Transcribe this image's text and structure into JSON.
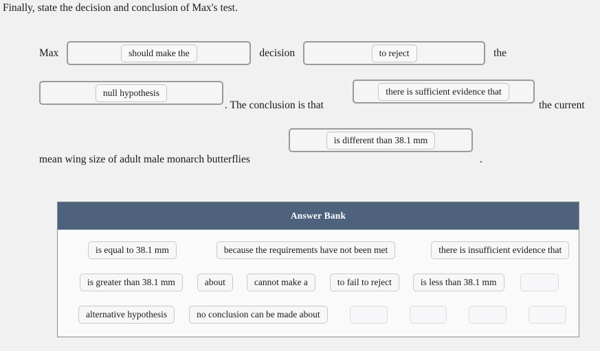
{
  "prompt": "Finally, state the decision and conclusion of Max's test.",
  "sentence": {
    "line1": {
      "lead": "Max",
      "slot1_value": "should make the",
      "mid": "decision",
      "slot2_value": "to reject",
      "tail": "the"
    },
    "line2": {
      "slot3_value": "null hypothesis",
      "mid": ". The conclusion is that",
      "slot4_value": "there is sufficient evidence that",
      "tail": "the current"
    },
    "line3": {
      "slot5_value": "is different than 38.1 mm",
      "lead": "mean wing size of adult male monarch butterflies",
      "period": "."
    }
  },
  "answer_bank": {
    "title": "Answer Bank",
    "rows": [
      [
        {
          "label": "is equal to 38.1 mm",
          "empty": false
        },
        {
          "label": "because the requirements have not been met",
          "empty": false
        },
        {
          "label": "there is insufficient evidence that",
          "empty": false
        }
      ],
      [
        {
          "label": "is greater than 38.1 mm",
          "empty": false
        },
        {
          "label": "about",
          "empty": false
        },
        {
          "label": "cannot make a",
          "empty": false
        },
        {
          "label": "to fail to reject",
          "empty": false
        },
        {
          "label": "is less than 38.1 mm",
          "empty": false
        },
        {
          "label": "",
          "empty": true
        }
      ],
      [
        {
          "label": "alternative hypothesis",
          "empty": false
        },
        {
          "label": "no conclusion can be made about",
          "empty": false
        },
        {
          "label": "",
          "empty": true
        },
        {
          "label": "",
          "empty": true
        },
        {
          "label": "",
          "empty": true
        },
        {
          "label": "",
          "empty": true
        }
      ]
    ]
  },
  "colors": {
    "page_background": "#f1f1f1",
    "bank_header": "#4e627d",
    "bank_body": "#fafafa",
    "dropzone_border": "#9a9a9a",
    "tile_border": "#c9c9cd",
    "text": "#1b1b1b"
  }
}
